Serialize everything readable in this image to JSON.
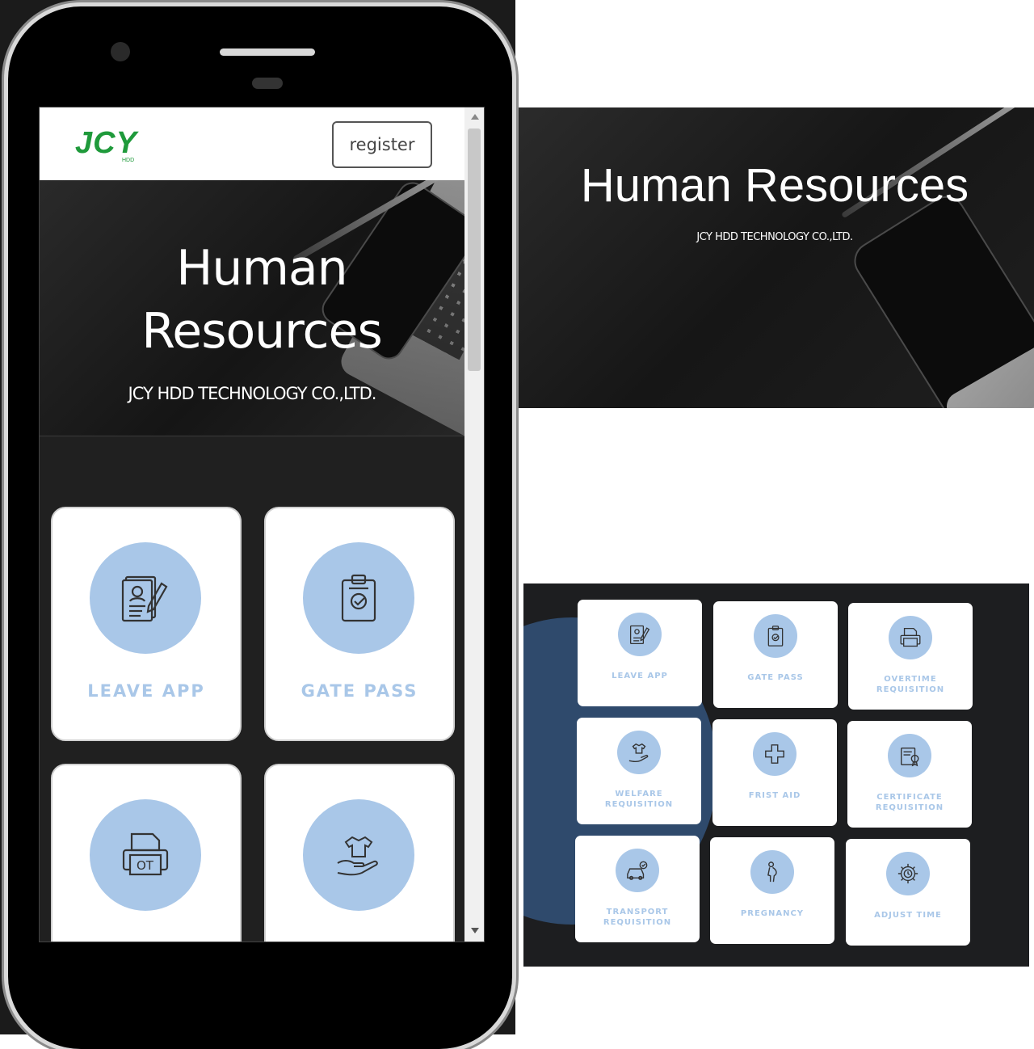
{
  "app": {
    "logo_text": "JCY",
    "logo_subtext": "HDD",
    "register_label": "register"
  },
  "hero": {
    "title": "Human Resources",
    "subtitle": "JCY HDD TECHNOLOGY CO.,LTD."
  },
  "mobile_cards": [
    {
      "label": "LEAVE APP",
      "icon": "resume-pen-icon"
    },
    {
      "label": "GATE PASS",
      "icon": "clipboard-check-icon"
    },
    {
      "label": "",
      "icon": "ot-printer-icon"
    },
    {
      "label": "",
      "icon": "hand-shirt-icon"
    }
  ],
  "tiles": [
    {
      "label": "LEAVE APP",
      "icon": "resume-pen-icon"
    },
    {
      "label": "GATE PASS",
      "icon": "clipboard-check-icon"
    },
    {
      "label": "OVERTIME REQUISITION",
      "icon": "ot-printer-icon"
    },
    {
      "label": "WELFARE REQUISITION",
      "icon": "hand-shirt-icon"
    },
    {
      "label": "FRIST AID",
      "icon": "first-aid-icon"
    },
    {
      "label": "CERTIFICATE REQUISITION",
      "icon": "certificate-icon"
    },
    {
      "label": "TRANSPORT REQUISITION",
      "icon": "car-check-icon"
    },
    {
      "label": "PREGNANCY",
      "icon": "pregnancy-icon"
    },
    {
      "label": "ADJUST TIME",
      "icon": "gear-clock-icon"
    }
  ],
  "colors": {
    "accent": "#a9c7e8",
    "brand_green": "#1f9a3b",
    "dark_bg": "#1d1e20",
    "blob": "#2f4a6c"
  }
}
